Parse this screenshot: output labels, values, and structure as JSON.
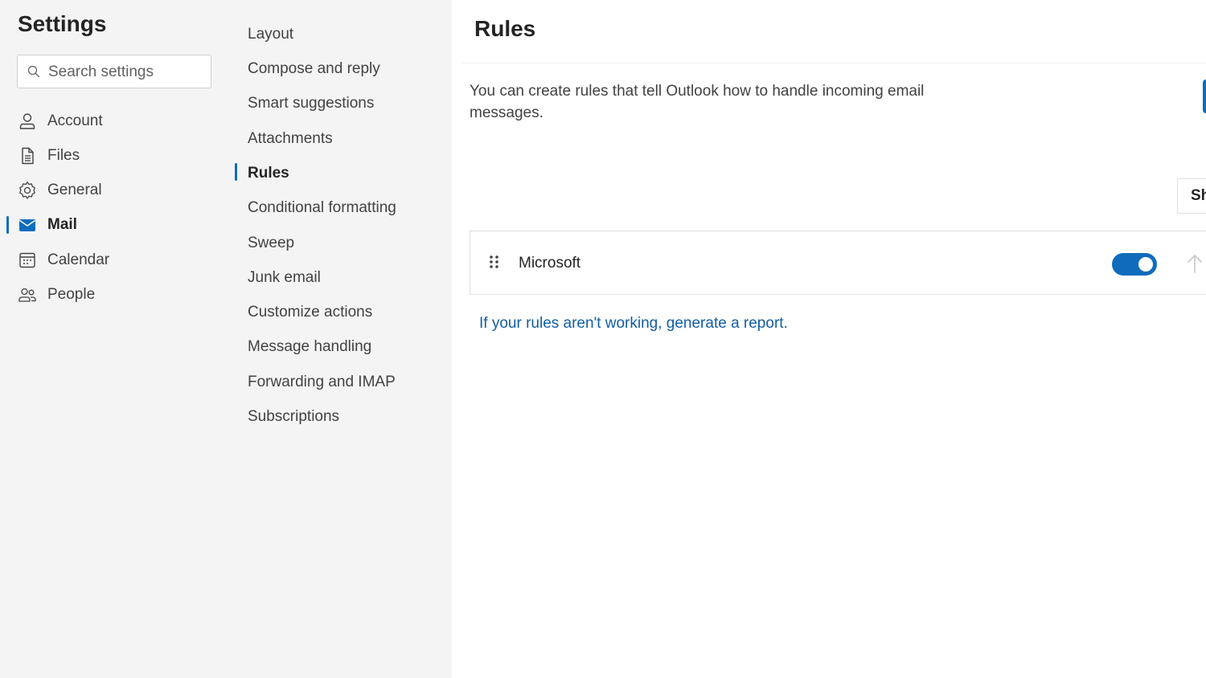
{
  "settings": {
    "title": "Settings",
    "search_placeholder": "Search settings"
  },
  "categories": [
    {
      "label": "Account",
      "icon": "person-icon"
    },
    {
      "label": "Files",
      "icon": "document-icon"
    },
    {
      "label": "General",
      "icon": "gear-icon"
    },
    {
      "label": "Mail",
      "icon": "mail-icon",
      "active": true
    },
    {
      "label": "Calendar",
      "icon": "calendar-icon"
    },
    {
      "label": "People",
      "icon": "people-icon"
    }
  ],
  "mail_sections": [
    {
      "label": "Layout"
    },
    {
      "label": "Compose and reply"
    },
    {
      "label": "Smart suggestions"
    },
    {
      "label": "Attachments"
    },
    {
      "label": "Rules",
      "active": true
    },
    {
      "label": "Conditional formatting"
    },
    {
      "label": "Sweep"
    },
    {
      "label": "Junk email"
    },
    {
      "label": "Customize actions"
    },
    {
      "label": "Message handling"
    },
    {
      "label": "Forwarding and IMAP"
    },
    {
      "label": "Subscriptions"
    }
  ],
  "main": {
    "title": "Rules",
    "description": "You can create rules that tell Outlook how to handle incoming email messages.",
    "sort_button_label": "Sh",
    "rules": [
      {
        "name": "Microsoft",
        "enabled": true
      }
    ],
    "report_link": "If your rules aren't working, generate a report."
  },
  "colors": {
    "accent": "#0f6cbd",
    "link": "#115ea3",
    "pane_background": "#f4f4f5"
  }
}
